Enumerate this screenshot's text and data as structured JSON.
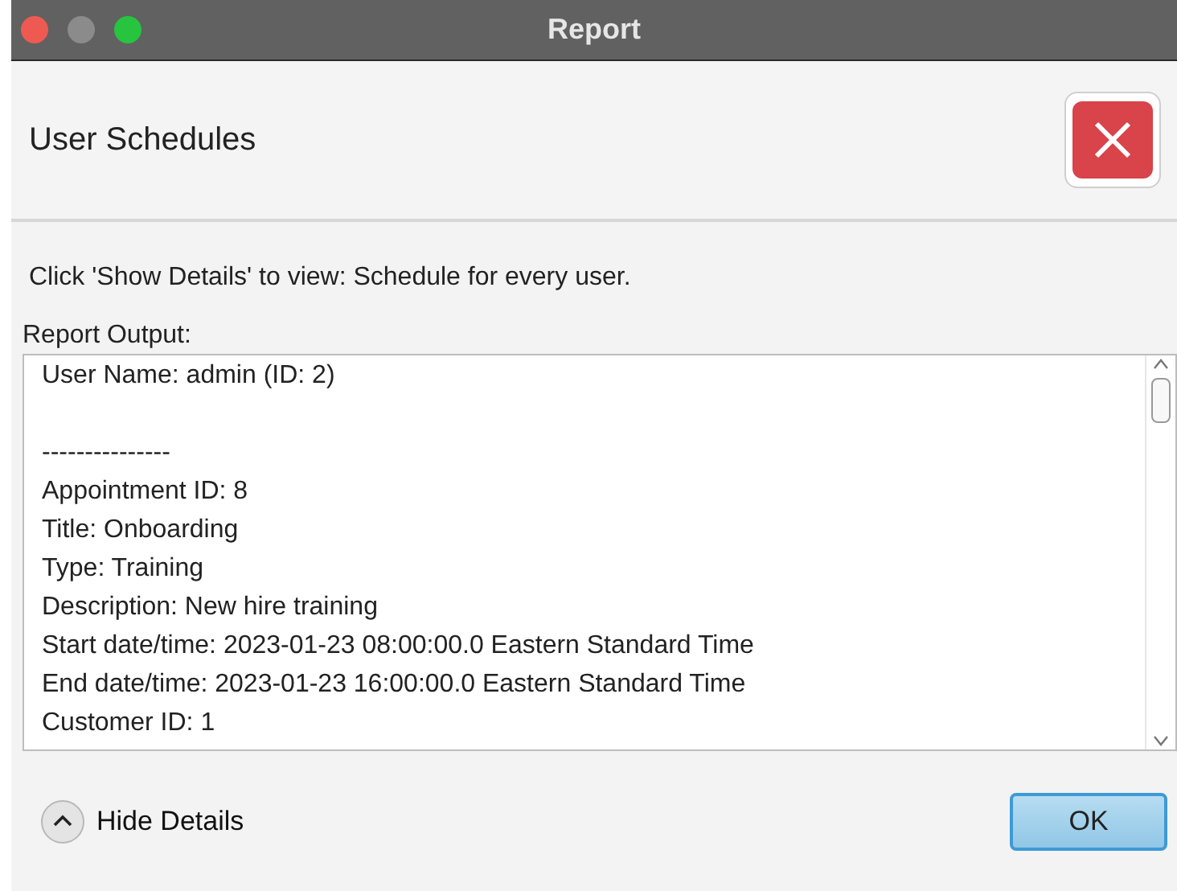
{
  "window": {
    "title": "Report",
    "controls": [
      {
        "kind": "close"
      },
      {
        "kind": "minimize"
      },
      {
        "kind": "zoom"
      }
    ]
  },
  "header": {
    "title": "User Schedules"
  },
  "message": "Click 'Show Details' to view: Schedule for every user.",
  "report": {
    "label": "Report Output:",
    "user_line": "User Name: admin (ID: 2)",
    "entry_lines": [
      "---------------",
      "Appointment ID: 8",
      "Title: Onboarding",
      "Type: Training",
      "Description: New hire training",
      "Start date/time: 2023-01-23 08:00:00.0 Eastern Standard Time",
      "End date/time: 2023-01-23 16:00:00.0 Eastern Standard Time",
      "Customer ID: 1"
    ]
  },
  "details_toggle": {
    "label": "Hide Details",
    "expanded": true
  },
  "buttons": [
    {
      "label": "OK",
      "default": true
    }
  ]
}
